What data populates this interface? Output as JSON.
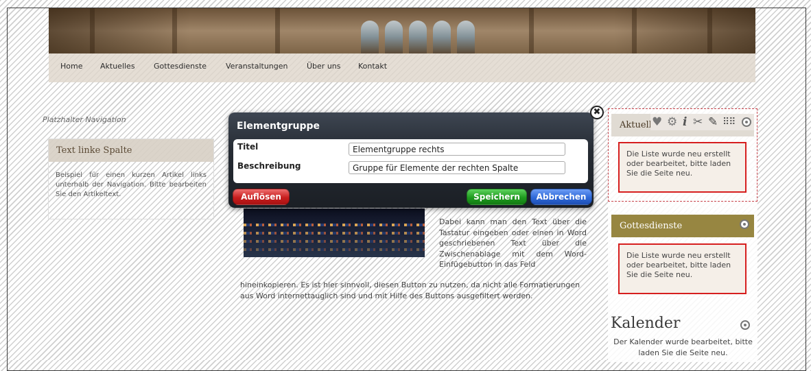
{
  "nav": {
    "items": [
      "Home",
      "Aktuelles",
      "Gottesdienste",
      "Veranstaltungen",
      "Über uns",
      "Kontakt"
    ]
  },
  "left": {
    "placeholder": "Platzhalter Navigation",
    "box_title": "Text linke Spalte",
    "box_text": "Beispiel für einen kurzen Artikel links unterhalb der Navigation. Bitte bearbeiten Sie den Artikeltext."
  },
  "main": {
    "text_side": "Dabei kann man den Text über die Tastatur eingeben oder einen in Word geschriebenen Text über die Zwischenablage mit dem Word-Einfügebutton in das Feld",
    "text_full": "hineinkopieren. Es ist hier sinnvoll, diesen Button zu nutzen, da nicht alle Formatierungen aus Word internettauglich sind und mit Hilfe des Buttons ausgefiltert werden."
  },
  "right": {
    "aktuell_title": "Aktuell",
    "notice_1": "Die Liste wurde neu erstellt oder bearbeitet, bitte laden Sie die Seite neu.",
    "gottes_title": "Gottesdienste",
    "notice_2": "Die Liste wurde neu erstellt oder bearbeitet, bitte laden Sie die Seite neu.",
    "kalender_title": "Kalender",
    "kalender_text": "Der Kalender wurde bearbeitet, bitte laden Sie die Seite neu."
  },
  "toolbar": {
    "icons": [
      "heart-plus-icon",
      "gear-icon",
      "info-icon",
      "scissors-icon",
      "pencil-icon",
      "grid-icon",
      "radio-icon"
    ],
    "info_glyph": "i"
  },
  "dialog": {
    "title": "Elementgruppe",
    "label_titel": "Titel",
    "value_titel": "Elementgruppe rechts",
    "label_beschreibung": "Beschreibung",
    "value_beschreibung": "Gruppe für Elemente der rechten Spalte",
    "btn_aufloesen": "Auflösen",
    "btn_speichern": "Speichern",
    "btn_abbrechen": "Abbrechen"
  },
  "colors": {
    "accent_red": "#d61e1e",
    "gottes_header": "#978641",
    "dialog_bg": "#262c34"
  }
}
